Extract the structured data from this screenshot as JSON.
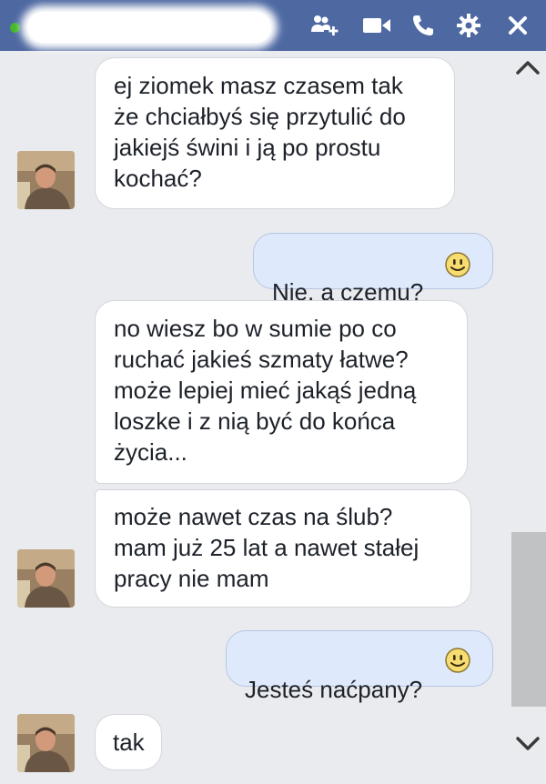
{
  "header": {
    "icons": [
      "online-status-dot",
      "add-people-icon",
      "video-call-icon",
      "voice-call-icon",
      "settings-gear-icon",
      "close-icon"
    ]
  },
  "messages": [
    {
      "from": "them",
      "text": "ej ziomek masz czasem tak\nże chciałbyś się przytulić do\njakiejś świni i ją po prostu\nkochać?"
    },
    {
      "from": "me",
      "text": "Nie, a czemu?",
      "emoji": "smiley"
    },
    {
      "from": "them",
      "text": "no wiesz bo w sumie po co\nruchać jakieś szmaty łatwe?\nmoże lepiej mieć jakąś jedną\nloszke i z nią być do końca\nżycia..."
    },
    {
      "from": "them",
      "text": "może nawet czas na ślub?\nmam już 25 lat a nawet stałej\npracy nie mam"
    },
    {
      "from": "me",
      "text": "Jesteś naćpany?",
      "emoji": "smiley"
    },
    {
      "from": "them",
      "text": "tak"
    }
  ],
  "colors": {
    "header": "#4e69a2",
    "background": "#e9ebee",
    "incoming_bubble": "#ffffff",
    "outgoing_bubble": "#dee9fb",
    "online_dot": "#42b72a"
  }
}
